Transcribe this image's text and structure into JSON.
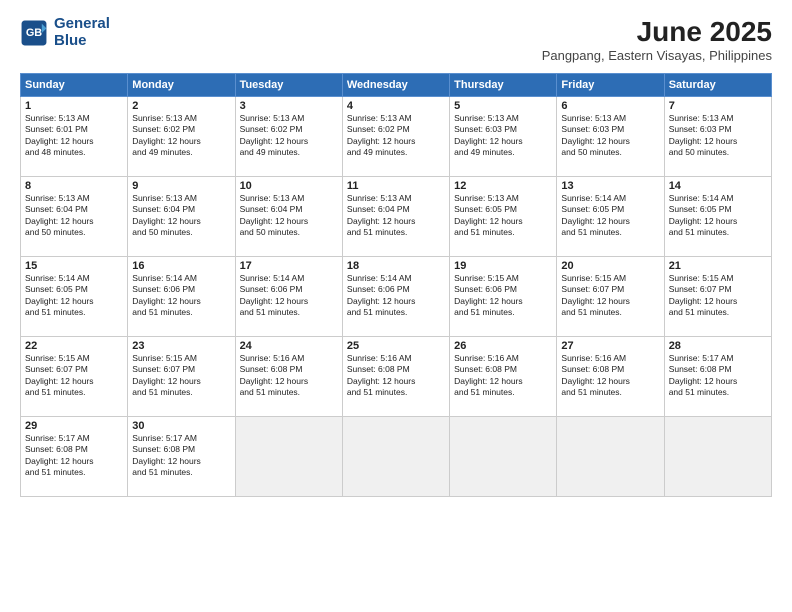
{
  "logo": {
    "line1": "General",
    "line2": "Blue"
  },
  "title": "June 2025",
  "location": "Pangpang, Eastern Visayas, Philippines",
  "days_header": [
    "Sunday",
    "Monday",
    "Tuesday",
    "Wednesday",
    "Thursday",
    "Friday",
    "Saturday"
  ],
  "weeks": [
    [
      {
        "day": "1",
        "lines": [
          "Sunrise: 5:13 AM",
          "Sunset: 6:01 PM",
          "Daylight: 12 hours",
          "and 48 minutes."
        ]
      },
      {
        "day": "2",
        "lines": [
          "Sunrise: 5:13 AM",
          "Sunset: 6:02 PM",
          "Daylight: 12 hours",
          "and 49 minutes."
        ]
      },
      {
        "day": "3",
        "lines": [
          "Sunrise: 5:13 AM",
          "Sunset: 6:02 PM",
          "Daylight: 12 hours",
          "and 49 minutes."
        ]
      },
      {
        "day": "4",
        "lines": [
          "Sunrise: 5:13 AM",
          "Sunset: 6:02 PM",
          "Daylight: 12 hours",
          "and 49 minutes."
        ]
      },
      {
        "day": "5",
        "lines": [
          "Sunrise: 5:13 AM",
          "Sunset: 6:03 PM",
          "Daylight: 12 hours",
          "and 49 minutes."
        ]
      },
      {
        "day": "6",
        "lines": [
          "Sunrise: 5:13 AM",
          "Sunset: 6:03 PM",
          "Daylight: 12 hours",
          "and 50 minutes."
        ]
      },
      {
        "day": "7",
        "lines": [
          "Sunrise: 5:13 AM",
          "Sunset: 6:03 PM",
          "Daylight: 12 hours",
          "and 50 minutes."
        ]
      }
    ],
    [
      {
        "day": "8",
        "lines": [
          "Sunrise: 5:13 AM",
          "Sunset: 6:04 PM",
          "Daylight: 12 hours",
          "and 50 minutes."
        ]
      },
      {
        "day": "9",
        "lines": [
          "Sunrise: 5:13 AM",
          "Sunset: 6:04 PM",
          "Daylight: 12 hours",
          "and 50 minutes."
        ]
      },
      {
        "day": "10",
        "lines": [
          "Sunrise: 5:13 AM",
          "Sunset: 6:04 PM",
          "Daylight: 12 hours",
          "and 50 minutes."
        ]
      },
      {
        "day": "11",
        "lines": [
          "Sunrise: 5:13 AM",
          "Sunset: 6:04 PM",
          "Daylight: 12 hours",
          "and 51 minutes."
        ]
      },
      {
        "day": "12",
        "lines": [
          "Sunrise: 5:13 AM",
          "Sunset: 6:05 PM",
          "Daylight: 12 hours",
          "and 51 minutes."
        ]
      },
      {
        "day": "13",
        "lines": [
          "Sunrise: 5:14 AM",
          "Sunset: 6:05 PM",
          "Daylight: 12 hours",
          "and 51 minutes."
        ]
      },
      {
        "day": "14",
        "lines": [
          "Sunrise: 5:14 AM",
          "Sunset: 6:05 PM",
          "Daylight: 12 hours",
          "and 51 minutes."
        ]
      }
    ],
    [
      {
        "day": "15",
        "lines": [
          "Sunrise: 5:14 AM",
          "Sunset: 6:05 PM",
          "Daylight: 12 hours",
          "and 51 minutes."
        ]
      },
      {
        "day": "16",
        "lines": [
          "Sunrise: 5:14 AM",
          "Sunset: 6:06 PM",
          "Daylight: 12 hours",
          "and 51 minutes."
        ]
      },
      {
        "day": "17",
        "lines": [
          "Sunrise: 5:14 AM",
          "Sunset: 6:06 PM",
          "Daylight: 12 hours",
          "and 51 minutes."
        ]
      },
      {
        "day": "18",
        "lines": [
          "Sunrise: 5:14 AM",
          "Sunset: 6:06 PM",
          "Daylight: 12 hours",
          "and 51 minutes."
        ]
      },
      {
        "day": "19",
        "lines": [
          "Sunrise: 5:15 AM",
          "Sunset: 6:06 PM",
          "Daylight: 12 hours",
          "and 51 minutes."
        ]
      },
      {
        "day": "20",
        "lines": [
          "Sunrise: 5:15 AM",
          "Sunset: 6:07 PM",
          "Daylight: 12 hours",
          "and 51 minutes."
        ]
      },
      {
        "day": "21",
        "lines": [
          "Sunrise: 5:15 AM",
          "Sunset: 6:07 PM",
          "Daylight: 12 hours",
          "and 51 minutes."
        ]
      }
    ],
    [
      {
        "day": "22",
        "lines": [
          "Sunrise: 5:15 AM",
          "Sunset: 6:07 PM",
          "Daylight: 12 hours",
          "and 51 minutes."
        ]
      },
      {
        "day": "23",
        "lines": [
          "Sunrise: 5:15 AM",
          "Sunset: 6:07 PM",
          "Daylight: 12 hours",
          "and 51 minutes."
        ]
      },
      {
        "day": "24",
        "lines": [
          "Sunrise: 5:16 AM",
          "Sunset: 6:08 PM",
          "Daylight: 12 hours",
          "and 51 minutes."
        ]
      },
      {
        "day": "25",
        "lines": [
          "Sunrise: 5:16 AM",
          "Sunset: 6:08 PM",
          "Daylight: 12 hours",
          "and 51 minutes."
        ]
      },
      {
        "day": "26",
        "lines": [
          "Sunrise: 5:16 AM",
          "Sunset: 6:08 PM",
          "Daylight: 12 hours",
          "and 51 minutes."
        ]
      },
      {
        "day": "27",
        "lines": [
          "Sunrise: 5:16 AM",
          "Sunset: 6:08 PM",
          "Daylight: 12 hours",
          "and 51 minutes."
        ]
      },
      {
        "day": "28",
        "lines": [
          "Sunrise: 5:17 AM",
          "Sunset: 6:08 PM",
          "Daylight: 12 hours",
          "and 51 minutes."
        ]
      }
    ],
    [
      {
        "day": "29",
        "lines": [
          "Sunrise: 5:17 AM",
          "Sunset: 6:08 PM",
          "Daylight: 12 hours",
          "and 51 minutes."
        ]
      },
      {
        "day": "30",
        "lines": [
          "Sunrise: 5:17 AM",
          "Sunset: 6:08 PM",
          "Daylight: 12 hours",
          "and 51 minutes."
        ]
      },
      {
        "day": "",
        "lines": []
      },
      {
        "day": "",
        "lines": []
      },
      {
        "day": "",
        "lines": []
      },
      {
        "day": "",
        "lines": []
      },
      {
        "day": "",
        "lines": []
      }
    ]
  ]
}
